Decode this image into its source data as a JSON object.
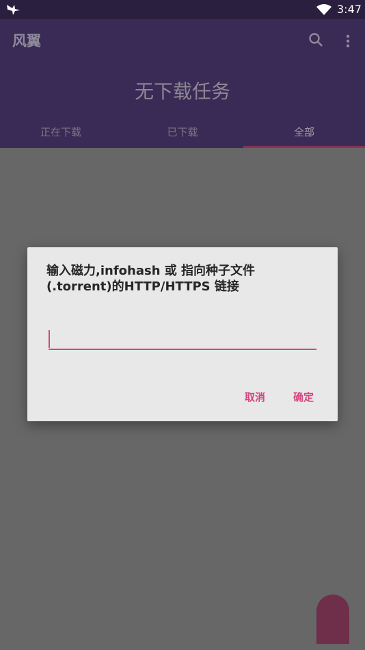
{
  "status_bar": {
    "time": "3:47",
    "icons": [
      "notification-bird-icon",
      "wifi-icon"
    ]
  },
  "app": {
    "title": "风翼",
    "empty_message": "无下载任务",
    "actions": [
      "search-icon",
      "more-vert-icon"
    ]
  },
  "tabs": [
    {
      "label": "正在下载",
      "active": false
    },
    {
      "label": "已下载",
      "active": false
    },
    {
      "label": "全部",
      "active": true
    }
  ],
  "dialog": {
    "title": "输入磁力,infohash 或 指向种子文件(.torrent)的HTTP/HTTPS 链接",
    "input_value": "",
    "cancel_label": "取消",
    "ok_label": "确定"
  },
  "colors": {
    "accent": "#d5457f",
    "primary": "#3a2b56",
    "scrim": "#676767"
  }
}
